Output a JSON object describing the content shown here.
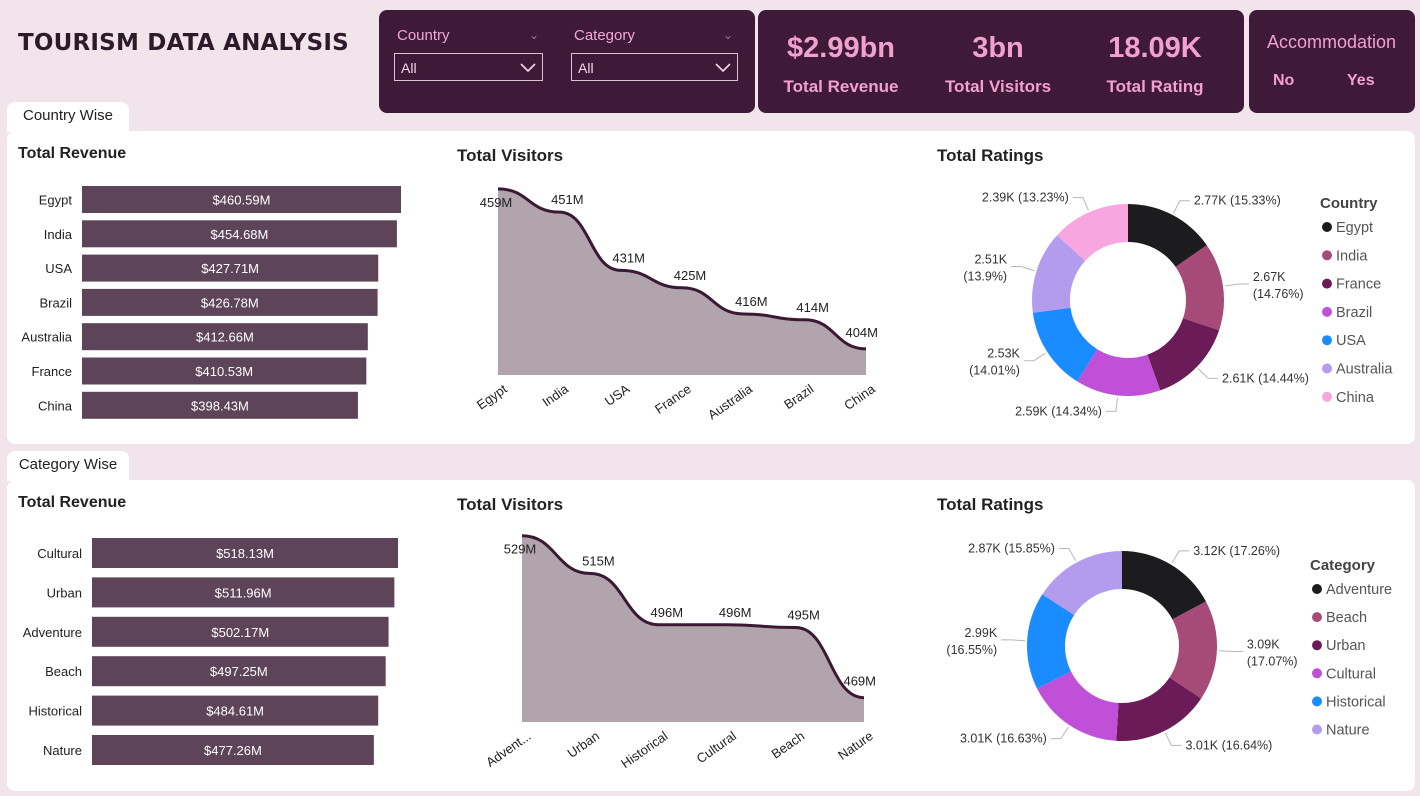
{
  "header": {
    "title": "TOURISM DATA ANALYSIS"
  },
  "filters": {
    "country": {
      "label": "Country",
      "value": "All"
    },
    "category": {
      "label": "Category",
      "value": "All"
    }
  },
  "kpis": [
    {
      "value": "$2.99bn",
      "label": "Total Revenue"
    },
    {
      "value": "3bn",
      "label": "Total Visitors"
    },
    {
      "value": "18.09K",
      "label": "Total Rating"
    }
  ],
  "accommodation": {
    "title": "Accommodation",
    "options": [
      "No",
      "Yes"
    ]
  },
  "sections": {
    "country": {
      "tab": "Country Wise",
      "revenue_title": "Total Revenue",
      "visitors_title": "Total Visitors",
      "ratings_title": "Total Ratings"
    },
    "category": {
      "tab": "Category Wise",
      "revenue_title": "Total Revenue",
      "visitors_title": "Total Visitors",
      "ratings_title": "Total Ratings"
    }
  },
  "colors": {
    "bar": "#5e4458",
    "area_fill": "#b2a4ad",
    "area_line": "#3a1a32",
    "accent": "#f2a0cc",
    "dark_card": "#3e1a38"
  },
  "chart_data": [
    {
      "id": "country-revenue",
      "type": "bar",
      "orientation": "horizontal",
      "title": "Total Revenue",
      "categories": [
        "Egypt",
        "India",
        "USA",
        "Brazil",
        "Australia",
        "France",
        "China"
      ],
      "values": [
        460.59,
        454.68,
        427.71,
        426.78,
        412.66,
        410.53,
        398.43
      ],
      "labels": [
        "$460.59M",
        "$454.68M",
        "$427.71M",
        "$426.78M",
        "$412.66M",
        "$410.53M",
        "$398.43M"
      ],
      "xlim": [
        0,
        460.59
      ]
    },
    {
      "id": "country-visitors",
      "type": "area",
      "title": "Total Visitors",
      "categories": [
        "Egypt",
        "India",
        "USA",
        "France",
        "Australia",
        "Brazil",
        "China"
      ],
      "values": [
        459,
        451,
        431,
        425,
        416,
        414,
        404
      ],
      "labels": [
        "459M",
        "451M",
        "431M",
        "425M",
        "416M",
        "414M",
        "404M"
      ],
      "ylim": [
        395,
        460
      ]
    },
    {
      "id": "country-ratings",
      "type": "pie",
      "donut": true,
      "title": "Total Ratings",
      "legend_title": "Country",
      "categories": [
        "Egypt",
        "India",
        "France",
        "Brazil",
        "USA",
        "Australia",
        "China"
      ],
      "values": [
        2.77,
        2.67,
        2.61,
        2.59,
        2.53,
        2.51,
        2.39
      ],
      "percents": [
        15.33,
        14.76,
        14.44,
        14.34,
        14.01,
        13.9,
        13.23
      ],
      "labels": [
        "2.77K (15.33%)",
        "2.67K (14.76%)",
        "2.61K (14.44%)",
        "2.59K (14.34%)",
        "2.53K (14.01%)",
        "2.51K (13.9%)",
        "2.39K (13.23%)"
      ],
      "colors": [
        "#1c1b1d",
        "#a64a78",
        "#6b1c58",
        "#c050d8",
        "#1a8cff",
        "#b39cee",
        "#f8a6e0"
      ]
    },
    {
      "id": "category-revenue",
      "type": "bar",
      "orientation": "horizontal",
      "title": "Total Revenue",
      "categories": [
        "Cultural",
        "Urban",
        "Adventure",
        "Beach",
        "Historical",
        "Nature"
      ],
      "values": [
        518.13,
        511.96,
        502.17,
        497.25,
        484.61,
        477.26
      ],
      "labels": [
        "$518.13M",
        "$511.96M",
        "$502.17M",
        "$497.25M",
        "$484.61M",
        "$477.26M"
      ],
      "xlim": [
        0,
        518.13
      ]
    },
    {
      "id": "category-visitors",
      "type": "area",
      "title": "Total Visitors",
      "categories": [
        "Advent...",
        "Urban",
        "Historical",
        "Cultural",
        "Beach",
        "Nature"
      ],
      "values": [
        529,
        515,
        496,
        496,
        495,
        469
      ],
      "labels": [
        "529M",
        "515M",
        "496M",
        "496M",
        "495M",
        "469M"
      ],
      "ylim": [
        460,
        530
      ]
    },
    {
      "id": "category-ratings",
      "type": "pie",
      "donut": true,
      "title": "Total Ratings",
      "legend_title": "Category",
      "categories": [
        "Adventure",
        "Beach",
        "Urban",
        "Cultural",
        "Historical",
        "Nature"
      ],
      "values": [
        3.12,
        3.09,
        3.01,
        3.01,
        2.99,
        2.87
      ],
      "percents": [
        17.26,
        17.07,
        16.64,
        16.63,
        16.55,
        15.85
      ],
      "labels": [
        "3.12K (17.26%)",
        "3.09K (17.07%)",
        "3.01K (16.64%)",
        "3.01K (16.63%)",
        "2.99K (16.55%)",
        "2.87K (15.85%)"
      ],
      "colors": [
        "#1c1b1d",
        "#a64a78",
        "#6b1c58",
        "#c050d8",
        "#1a8cff",
        "#b39cee"
      ]
    }
  ]
}
